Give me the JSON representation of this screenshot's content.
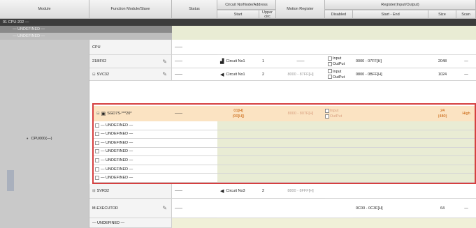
{
  "columns": {
    "module": "Module",
    "function_module": "Function Module/Slave",
    "status": "Status",
    "circuit_group": "Circuit No/Node/Address",
    "circuit_start": "Start",
    "circuit_used": "Upper circ",
    "motion_register": "Motion Register",
    "register_group": "Register(Input/Output)",
    "disabled": "Disabled",
    "start_end": "Start - End",
    "size": "Size",
    "scan": "Scan"
  },
  "tree": {
    "root": "01 CPU-202 —",
    "undefined1": "— UNDEFINED —",
    "undefined2": "— UNDEFINED —"
  },
  "cpu_module": "CPU000(—)",
  "rows": {
    "cpu": {
      "name": "CPU",
      "status": "——"
    },
    "r218": {
      "name": "218IF02",
      "status": "——",
      "circuit": "Circuit No1",
      "num": "1",
      "motion": "——",
      "input": "Input",
      "output": "OutPut",
      "range": "0000 - 07FF[H]",
      "size": "2048",
      "scan": "—"
    },
    "svb": {
      "name": "SVC32",
      "status": "——",
      "circuit": "Circuit No1",
      "num": "2",
      "motion": "8000 - 87FF[H]",
      "input": "Input",
      "output": "OutPut",
      "range": "0800 - 0BFF[H]",
      "size": "1024",
      "scan": "—"
    },
    "sgd": {
      "name": "SGD7S-***20*",
      "status": "——",
      "addr1": "01[H]",
      "addr2": "(00[H])",
      "motion": "8000 - 807F[H]",
      "input": "Input",
      "output": "OutPut",
      "size": "24",
      "size2": "(480)",
      "scan": "High"
    },
    "svr": {
      "name": "SVR32",
      "status": "——",
      "circuit": "Circuit No3",
      "num": "2",
      "motion": "8800 - 8FFF[H]"
    },
    "mexe": {
      "name": "M-EXECUTOR",
      "status": "——",
      "range": "0C00 - 0C3F[H]",
      "size": "64",
      "scan": "—"
    },
    "undef_last": {
      "name": "— UNDEFINED —"
    }
  },
  "undefined_rows": [
    {
      "label": "— UNDEFINED —"
    },
    {
      "label": "— UNDEFINED —"
    },
    {
      "label": "— UNDEFINED —"
    },
    {
      "label": "— UNDEFINED —"
    },
    {
      "label": "— UNDEFINED —"
    },
    {
      "label": "— UNDEFINED —"
    },
    {
      "label": "— UNDEFINED —"
    }
  ],
  "colors": {
    "selection": "#d64040",
    "highlight": "#fbe3c2",
    "empty_register": "#f0f0d8"
  }
}
